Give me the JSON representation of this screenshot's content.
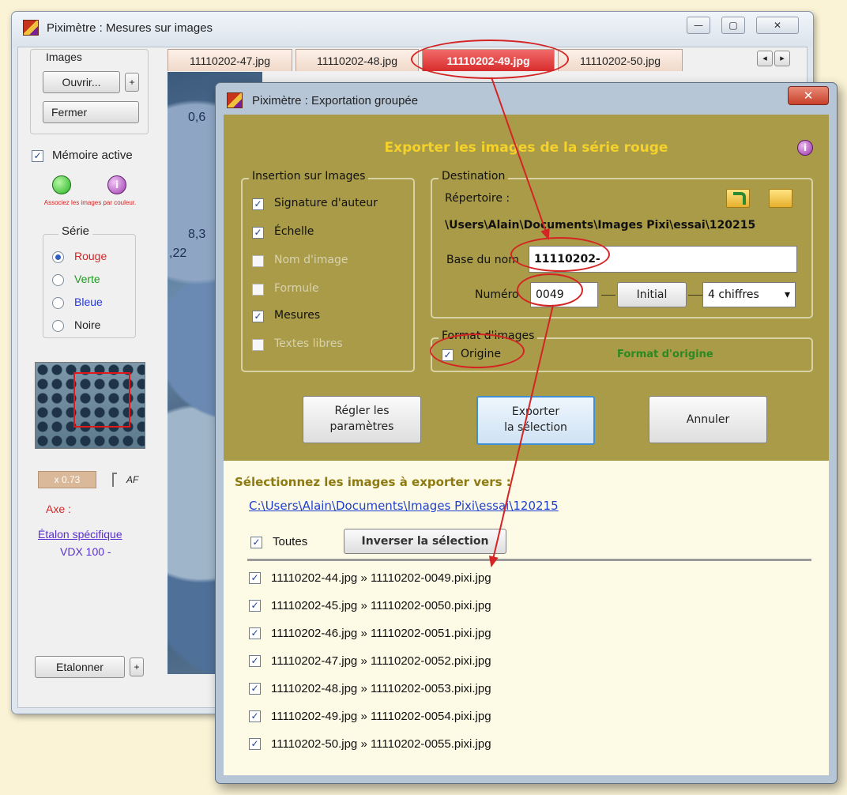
{
  "main_window": {
    "title": "Piximètre : Mesures sur images",
    "controls": {
      "minimize": "—",
      "maximize": "▢",
      "close": "✕"
    },
    "tabs": [
      "11110202-47.jpg",
      "11110202-48.jpg",
      "11110202-49.jpg",
      "11110202-50.jpg"
    ],
    "active_tab_index": 2,
    "tab_scroll": {
      "left": "◂",
      "right": "▸"
    },
    "images_group": {
      "label": "Images",
      "open_button": "Ouvrir...",
      "plus": "+",
      "close_button": "Fermer"
    },
    "memory_label": "Mémoire active",
    "memory_checked": true,
    "associate_note": "Associez les images par couleur.",
    "series_group": {
      "label": "Série",
      "options": [
        {
          "label": "Rouge",
          "color": "#d42424",
          "selected": true
        },
        {
          "label": "Verte",
          "color": "#1f9a1f",
          "selected": false
        },
        {
          "label": "Bleue",
          "color": "#2438d8",
          "selected": false
        },
        {
          "label": "Noire",
          "color": "#222222",
          "selected": false
        }
      ]
    },
    "zoom_value": "x 0.73",
    "af_label": "AF",
    "axis_label": "Axe :",
    "calibration_link": "Étalon spécifique",
    "calibration_value": "VDX 100 -",
    "calibrate_button": "Etalonner",
    "calibrate_plus": "+",
    "overlay_values": [
      "0,6",
      "8,3",
      ",22"
    ]
  },
  "dialog": {
    "title": "Piximètre : Exportation groupée",
    "close": "✕",
    "heading": "Exporter les images de la série rouge",
    "info_icon": "i",
    "insertion_group": {
      "legend": "Insertion sur Images",
      "items": [
        {
          "label": "Signature d'auteur",
          "checked": true,
          "enabled": true
        },
        {
          "label": "Échelle",
          "checked": true,
          "enabled": true
        },
        {
          "label": "Nom d'image",
          "checked": false,
          "enabled": false
        },
        {
          "label": "Formule",
          "checked": false,
          "enabled": false
        },
        {
          "label": "Mesures",
          "checked": true,
          "enabled": true
        },
        {
          "label": "Textes libres",
          "checked": false,
          "enabled": false
        }
      ]
    },
    "destination_group": {
      "legend": "Destination",
      "directory_label": "Répertoire :",
      "directory_path": "\\Users\\Alain\\Documents\\Images Pixi\\essai\\120215",
      "base_name_label": "Base du nom",
      "base_name_value": "11110202-",
      "number_label": "Numéro",
      "number_value": "0049",
      "initial_button": "Initial",
      "digits_select": "4 chiffres"
    },
    "format_group": {
      "legend": "Format d'images",
      "origin_label": "Origine",
      "origin_checked": true,
      "origin_format_text": "Format d'origine"
    },
    "buttons": {
      "settings_line1": "Régler les",
      "settings_line2": "paramètres",
      "export_line1": "Exporter",
      "export_line2": "la sélection",
      "cancel": "Annuler"
    },
    "select_prompt": "Sélectionnez les images à exporter vers :",
    "export_path": "C:\\Users\\Alain\\Documents\\Images Pixi\\essai\\120215",
    "all_label": "Toutes",
    "invert_button": "Inverser la sélection",
    "files": [
      {
        "source": "11110202-44.jpg",
        "target": "11110202-0049.pixi.jpg"
      },
      {
        "source": "11110202-45.jpg",
        "target": "11110202-0050.pixi.jpg"
      },
      {
        "source": "11110202-46.jpg",
        "target": "11110202-0051.pixi.jpg"
      },
      {
        "source": "11110202-47.jpg",
        "target": "11110202-0052.pixi.jpg"
      },
      {
        "source": "11110202-48.jpg",
        "target": "11110202-0053.pixi.jpg"
      },
      {
        "source": "11110202-49.jpg",
        "target": "11110202-0054.pixi.jpg"
      },
      {
        "source": "11110202-50.jpg",
        "target": "11110202-0055.pixi.jpg"
      }
    ],
    "arrow_glyph": "»"
  },
  "colors": {
    "dialog_olive": "#a99b47",
    "heading_yellow": "#f5d22a",
    "annotation_red": "#d42424",
    "link_blue": "#1f3fd0"
  }
}
